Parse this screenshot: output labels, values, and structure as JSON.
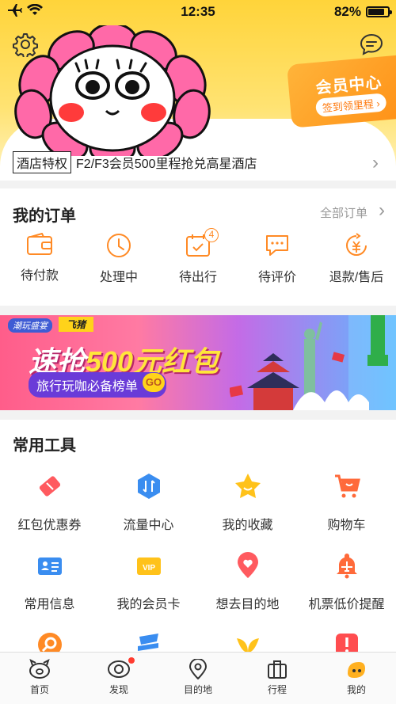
{
  "status_bar": {
    "time": "12:35",
    "battery": "82%",
    "battery_level": 0.82
  },
  "member_card": {
    "title": "会员中心",
    "subtitle": "签到领里程 ›"
  },
  "privilege": {
    "tag": "酒店特权",
    "text": "F2/F3会员500里程抢兑高星酒店"
  },
  "orders": {
    "title": "我的订单",
    "all_link": "全部订单",
    "items": [
      {
        "label": "待付款",
        "icon": "wallet-icon"
      },
      {
        "label": "处理中",
        "icon": "clock-icon"
      },
      {
        "label": "待出行",
        "icon": "calendar-check-icon",
        "badge": "4"
      },
      {
        "label": "待评价",
        "icon": "comment-icon"
      },
      {
        "label": "退款/售后",
        "icon": "refund-icon"
      }
    ]
  },
  "banner": {
    "tag1": "潮玩盛宴",
    "tag2": "飞猪",
    "title_a": "速抢",
    "title_b": "500元红包",
    "subtitle": "旅行玩咖必备榜单",
    "go": "GO"
  },
  "tools": {
    "title": "常用工具",
    "rows": [
      [
        {
          "label": "红包优惠券",
          "icon": "coupon-icon"
        },
        {
          "label": "流量中心",
          "icon": "data-traffic-icon"
        },
        {
          "label": "我的收藏",
          "icon": "star-icon"
        },
        {
          "label": "购物车",
          "icon": "cart-icon"
        }
      ],
      [
        {
          "label": "常用信息",
          "icon": "id-card-icon"
        },
        {
          "label": "我的会员卡",
          "icon": "vip-card-icon"
        },
        {
          "label": "想去目的地",
          "icon": "heart-pin-icon"
        },
        {
          "label": "机票低价提醒",
          "icon": "flight-alarm-icon"
        }
      ]
    ]
  },
  "tabbar": [
    {
      "label": "首页",
      "icon": "home-pig-icon"
    },
    {
      "label": "发现",
      "icon": "eye-icon",
      "dot": true
    },
    {
      "label": "目的地",
      "icon": "location-pin-icon"
    },
    {
      "label": "行程",
      "icon": "suitcase-icon"
    },
    {
      "label": "我的",
      "icon": "profile-icon"
    }
  ],
  "colors": {
    "accent": "#ff8a25",
    "header_yellow": "#ffd43a"
  }
}
